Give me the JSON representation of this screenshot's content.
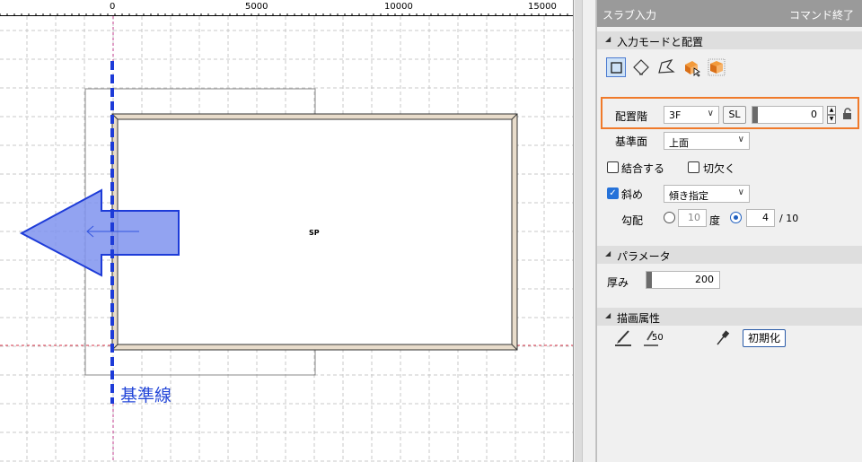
{
  "ruler": {
    "labels": [
      "0",
      "5000",
      "10000",
      "15000"
    ]
  },
  "canvas": {
    "sp_marker": "SP",
    "base_line_label": "基準線"
  },
  "panel": {
    "title": "スラブ入力",
    "end_command": "コマンド終了",
    "sections": {
      "input_mode": "入力モードと配置",
      "parameters": "パラメータ",
      "draw_attributes": "描画属性"
    },
    "mode_icons": [
      "rectangle-mode-icon",
      "diamond-mode-icon",
      "polygon-mode-icon",
      "pick-box-icon",
      "room-box-icon"
    ],
    "placement": {
      "floor_label": "配置階",
      "floor_value": "3F",
      "sl_button": "SL",
      "offset_value": "0"
    },
    "reference_plane": {
      "label": "基準面",
      "value": "上面"
    },
    "combine_label": "結合する",
    "notch_label": "切欠く",
    "slope": {
      "label": "斜め",
      "value": "傾き指定"
    },
    "pitch": {
      "label": "勾配",
      "degree_value": "10",
      "degree_unit": "度",
      "ratio_value": "4",
      "ratio_unit": "/ 10"
    },
    "thickness": {
      "label": "厚み",
      "value": "200"
    },
    "pen_weight": "50",
    "init_button": "初期化"
  },
  "colors": {
    "accent_orange": "#f07a2a",
    "base_line_blue": "#2346d8",
    "arrow_fill": "#7f93ef",
    "slab_fill": "#e8dccb"
  }
}
